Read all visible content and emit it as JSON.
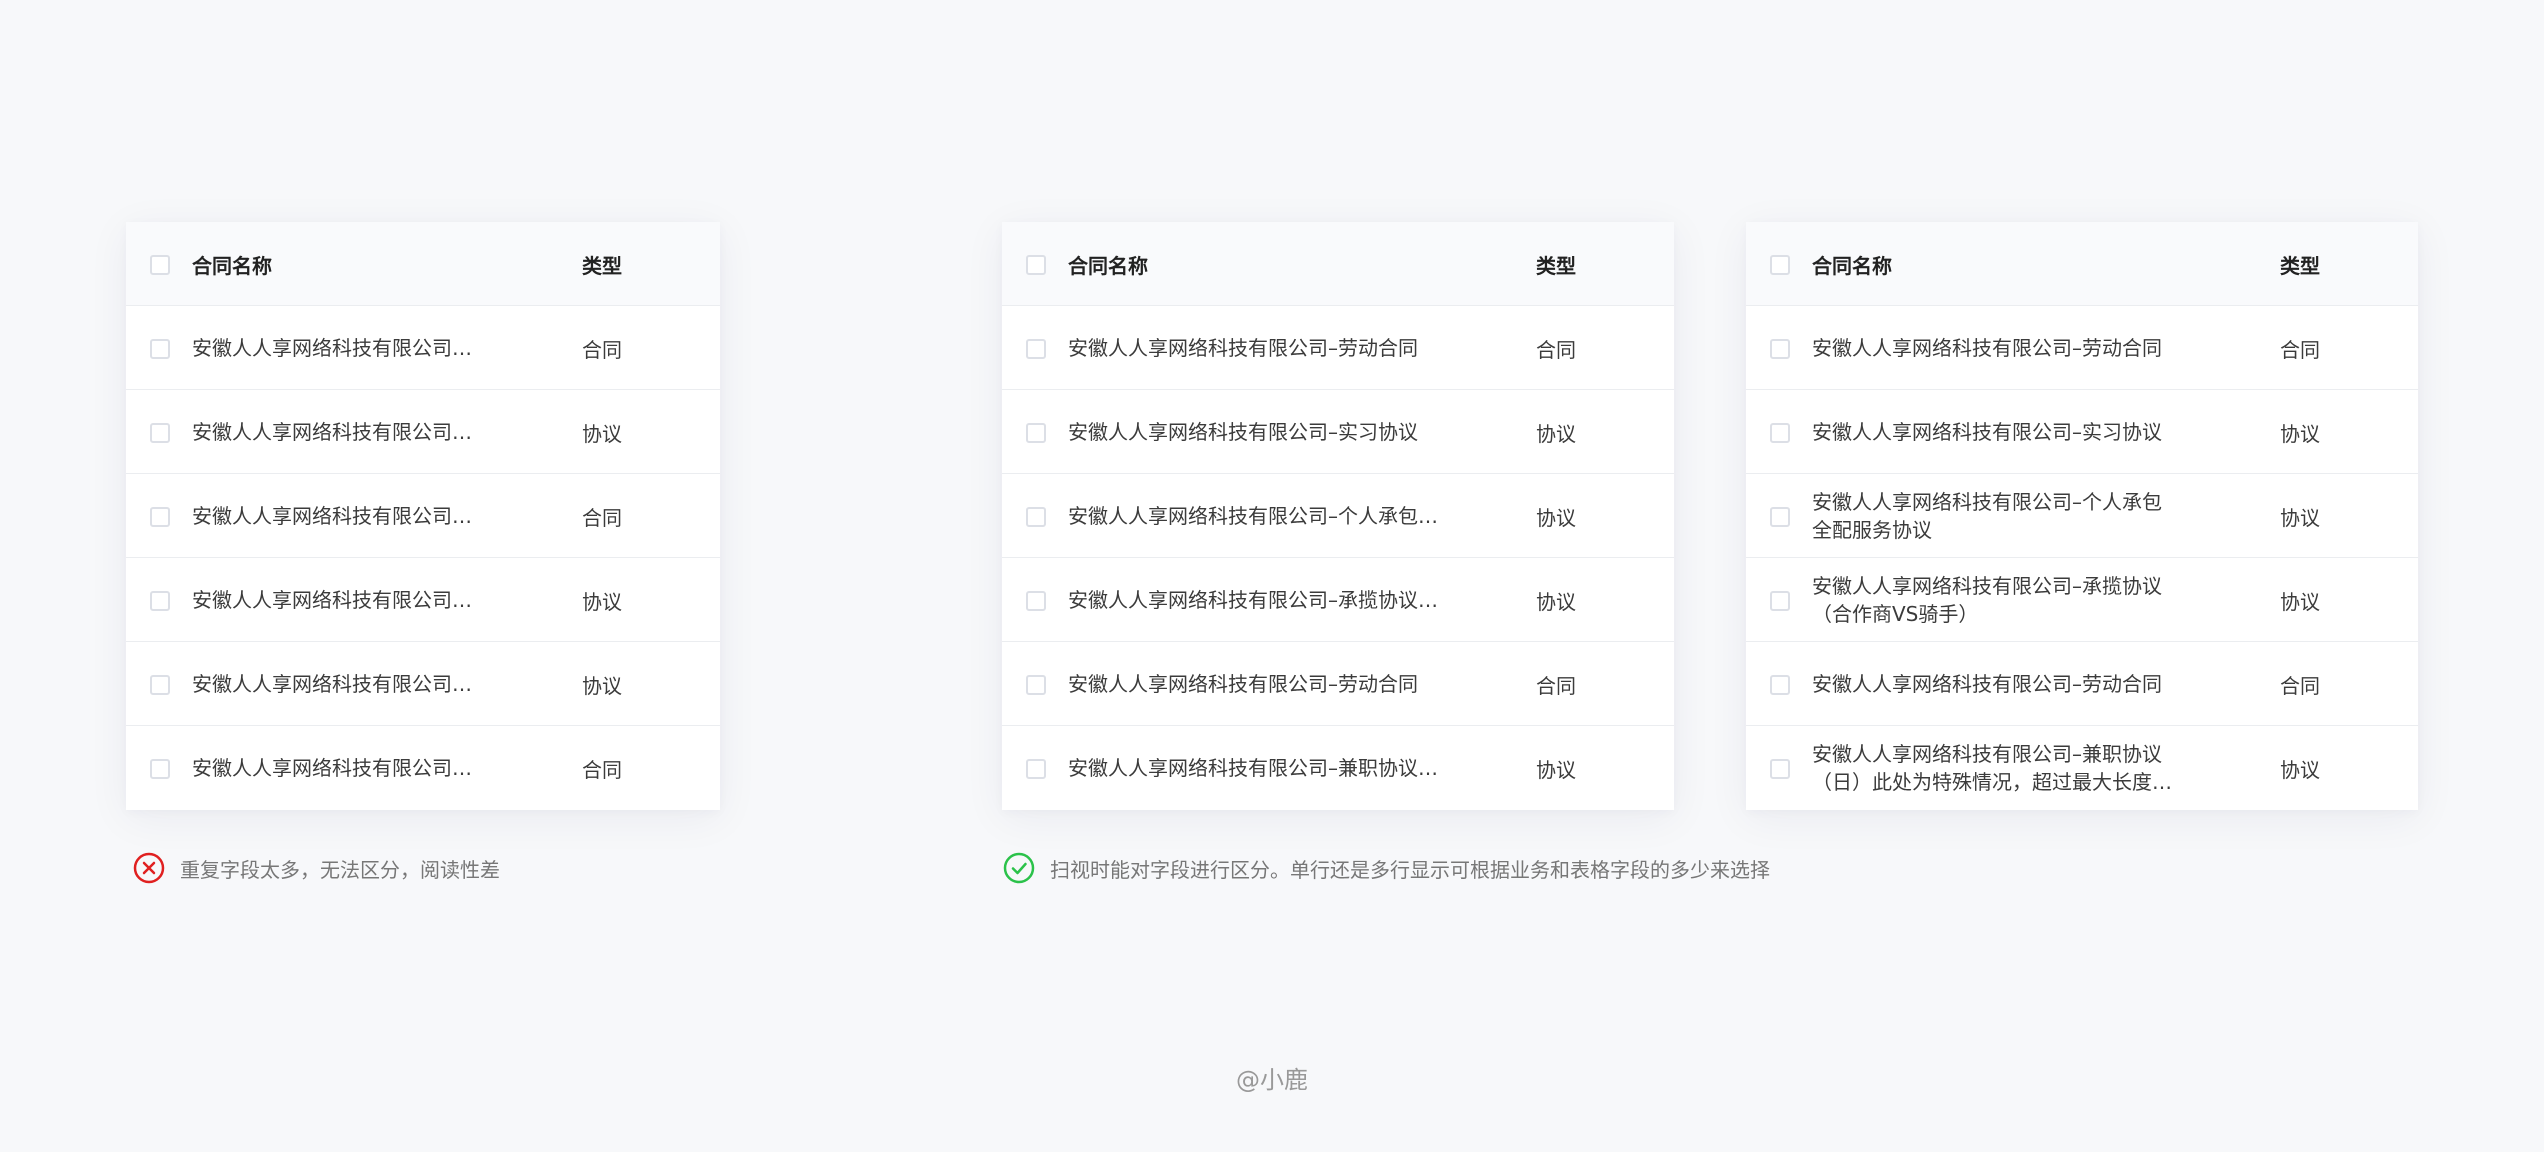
{
  "header": {
    "name_label": "合同名称",
    "type_label": "类型"
  },
  "table_left": {
    "rows": [
      {
        "name": "安徽人人享网络科技有限公司…",
        "type": "合同"
      },
      {
        "name": "安徽人人享网络科技有限公司…",
        "type": "协议"
      },
      {
        "name": "安徽人人享网络科技有限公司…",
        "type": "合同"
      },
      {
        "name": "安徽人人享网络科技有限公司…",
        "type": "协议"
      },
      {
        "name": "安徽人人享网络科技有限公司…",
        "type": "协议"
      },
      {
        "name": "安徽人人享网络科技有限公司…",
        "type": "合同"
      }
    ]
  },
  "table_middle": {
    "rows": [
      {
        "name": "安徽人人享网络科技有限公司–劳动合同",
        "type": "合同"
      },
      {
        "name": "安徽人人享网络科技有限公司–实习协议",
        "type": "协议"
      },
      {
        "name": "安徽人人享网络科技有限公司–个人承包…",
        "type": "协议"
      },
      {
        "name": "安徽人人享网络科技有限公司–承揽协议…",
        "type": "协议"
      },
      {
        "name": "安徽人人享网络科技有限公司–劳动合同",
        "type": "合同"
      },
      {
        "name": "安徽人人享网络科技有限公司–兼职协议…",
        "type": "协议"
      }
    ]
  },
  "table_right": {
    "rows": [
      {
        "line1": "安徽人人享网络科技有限公司–劳动合同",
        "line2": "",
        "type": "合同"
      },
      {
        "line1": "安徽人人享网络科技有限公司–实习协议",
        "line2": "",
        "type": "协议"
      },
      {
        "line1": "安徽人人享网络科技有限公司–个人承包",
        "line2": "全配服务协议",
        "type": "协议"
      },
      {
        "line1": "安徽人人享网络科技有限公司–承揽协议",
        "line2": "（合作商VS骑手）",
        "type": "协议"
      },
      {
        "line1": "安徽人人享网络科技有限公司–劳动合同",
        "line2": "",
        "type": "合同"
      },
      {
        "line1": "安徽人人享网络科技有限公司–兼职协议",
        "line2": "（日）此处为特殊情况，超过最大长度…",
        "type": "协议"
      }
    ]
  },
  "notes": {
    "bad": "重复字段太多，无法区分，阅读性差",
    "good": "扫视时能对字段进行区分。单行还是多行显示可根据业务和表格字段的多少来选择"
  },
  "colors": {
    "error": "#e02020",
    "success": "#2bc24a"
  },
  "icons": {
    "bad": "close-circle-icon",
    "good": "check-circle-icon"
  },
  "footer": {
    "credit": "@小鹿"
  }
}
